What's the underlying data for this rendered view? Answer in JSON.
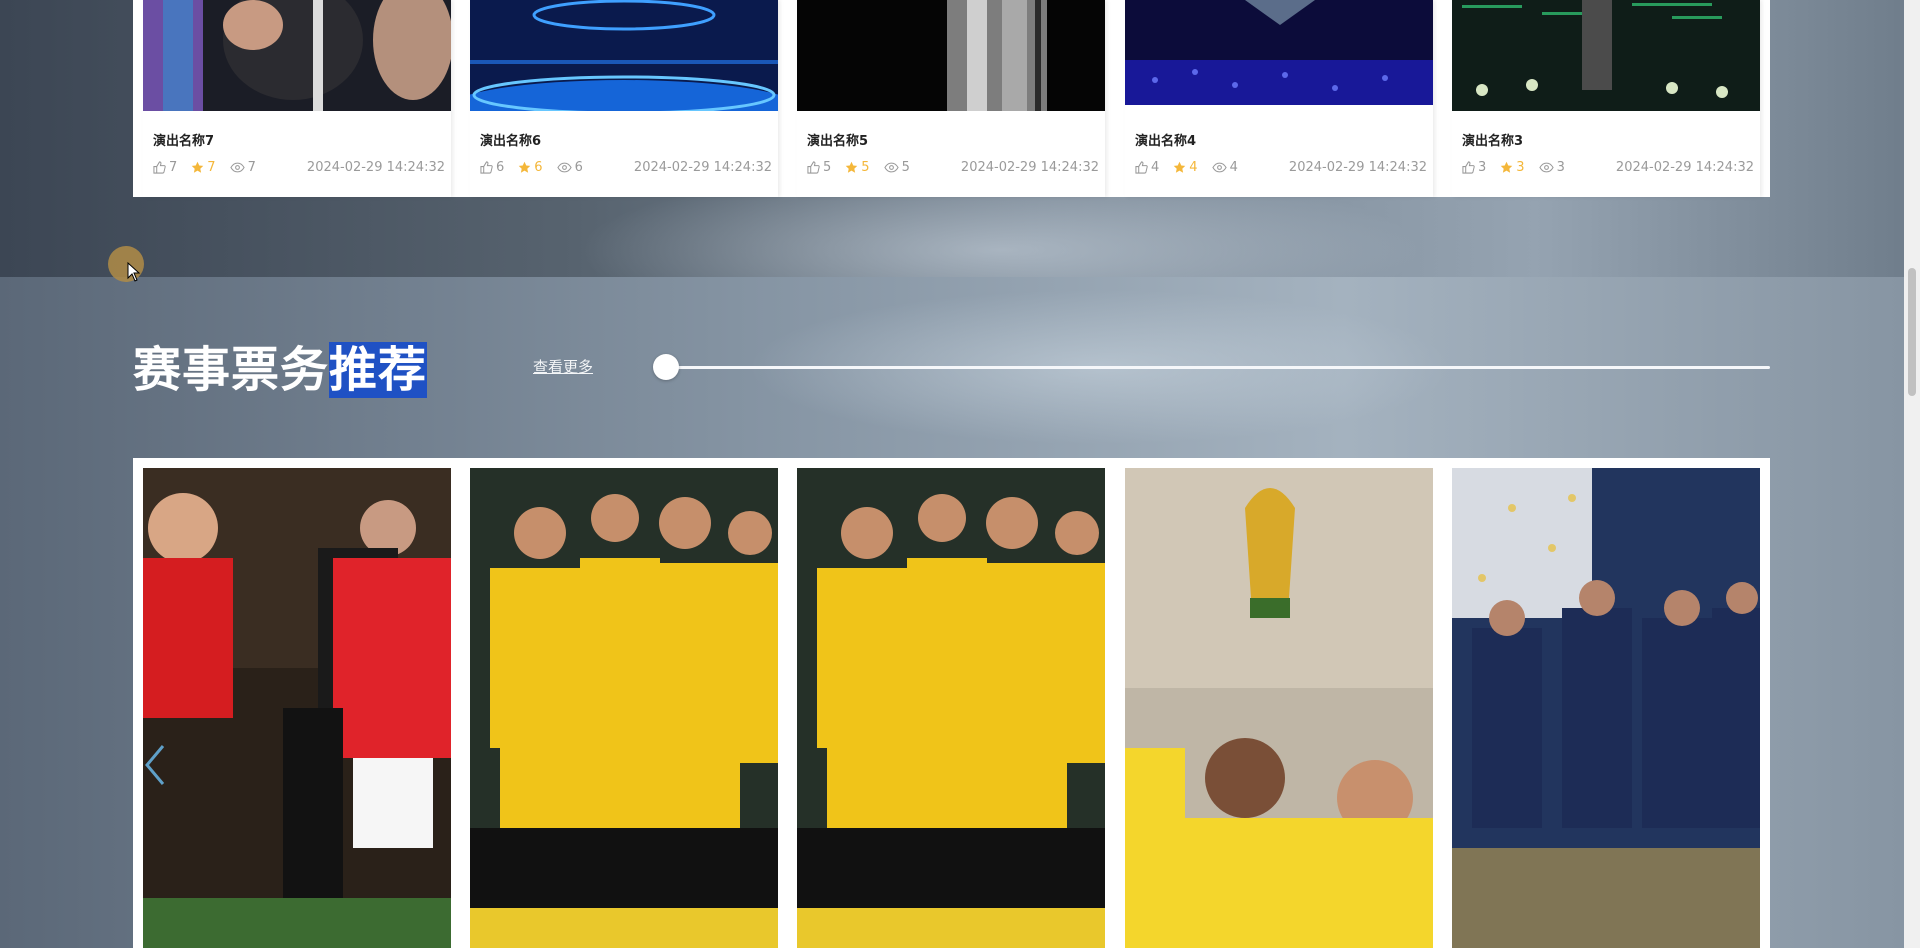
{
  "top_cards": [
    {
      "title": "演出名称7",
      "likes": "7",
      "favorites": "7",
      "views": "7",
      "date": "2024-02-29 14:24:32"
    },
    {
      "title": "演出名称6",
      "likes": "6",
      "favorites": "6",
      "views": "6",
      "date": "2024-02-29 14:24:32"
    },
    {
      "title": "演出名称5",
      "likes": "5",
      "favorites": "5",
      "views": "5",
      "date": "2024-02-29 14:24:32"
    },
    {
      "title": "演出名称4",
      "likes": "4",
      "favorites": "4",
      "views": "4",
      "date": "2024-02-29 14:24:32"
    },
    {
      "title": "演出名称3",
      "likes": "3",
      "favorites": "3",
      "views": "3",
      "date": "2024-02-29 14:24:32"
    }
  ],
  "section": {
    "title_plain": "赛事票务",
    "title_selected": "推荐",
    "more_label": "查看更多"
  },
  "photos": [
    {
      "icon": "football-photo-red-team"
    },
    {
      "icon": "football-photo-yellow-team"
    },
    {
      "icon": "football-photo-yellow-team"
    },
    {
      "icon": "football-photo-trophy"
    },
    {
      "icon": "football-photo-celebration"
    }
  ],
  "colors": {
    "selection": "#1f51c4",
    "favorite": "#f4b73a",
    "meta": "#999999"
  }
}
